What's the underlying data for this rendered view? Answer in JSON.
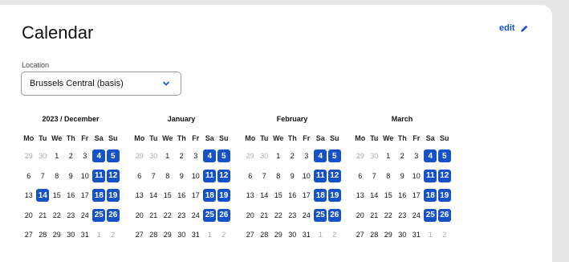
{
  "title": "Calendar",
  "edit_label": "edit",
  "location": {
    "label": "Location",
    "value": "Brussels Central (basis)"
  },
  "weekdays": [
    "Mo",
    "Tu",
    "We",
    "Th",
    "Fr",
    "Sa",
    "Su"
  ],
  "accent": "#1552c8",
  "months": [
    {
      "name": "2023 / December",
      "weeks": [
        [
          {
            "d": "29",
            "m": true
          },
          {
            "d": "30",
            "m": true
          },
          {
            "d": "1"
          },
          {
            "d": "2"
          },
          {
            "d": "3"
          },
          {
            "d": "4",
            "h": true
          },
          {
            "d": "5",
            "h": true
          }
        ],
        [
          {
            "d": "6"
          },
          {
            "d": "7"
          },
          {
            "d": "8"
          },
          {
            "d": "9"
          },
          {
            "d": "10"
          },
          {
            "d": "11",
            "h": true
          },
          {
            "d": "12",
            "h": true
          }
        ],
        [
          {
            "d": "13"
          },
          {
            "d": "14",
            "h": true
          },
          {
            "d": "15"
          },
          {
            "d": "16"
          },
          {
            "d": "17"
          },
          {
            "d": "18",
            "h": true
          },
          {
            "d": "19",
            "h": true
          }
        ],
        [
          {
            "d": "20"
          },
          {
            "d": "21"
          },
          {
            "d": "22"
          },
          {
            "d": "23"
          },
          {
            "d": "24"
          },
          {
            "d": "25",
            "h": true
          },
          {
            "d": "26",
            "h": true
          }
        ],
        [
          {
            "d": "27"
          },
          {
            "d": "28"
          },
          {
            "d": "29"
          },
          {
            "d": "30"
          },
          {
            "d": "31"
          },
          {
            "d": "1",
            "m": true
          },
          {
            "d": "2",
            "m": true
          }
        ]
      ]
    },
    {
      "name": "January",
      "weeks": [
        [
          {
            "d": "29",
            "m": true
          },
          {
            "d": "30",
            "m": true
          },
          {
            "d": "1"
          },
          {
            "d": "2"
          },
          {
            "d": "3"
          },
          {
            "d": "4",
            "h": true
          },
          {
            "d": "5",
            "h": true
          }
        ],
        [
          {
            "d": "6"
          },
          {
            "d": "7"
          },
          {
            "d": "8"
          },
          {
            "d": "9"
          },
          {
            "d": "10"
          },
          {
            "d": "11",
            "h": true
          },
          {
            "d": "12",
            "h": true
          }
        ],
        [
          {
            "d": "13"
          },
          {
            "d": "14"
          },
          {
            "d": "15"
          },
          {
            "d": "16"
          },
          {
            "d": "17"
          },
          {
            "d": "18",
            "h": true
          },
          {
            "d": "19",
            "h": true
          }
        ],
        [
          {
            "d": "20"
          },
          {
            "d": "21"
          },
          {
            "d": "22"
          },
          {
            "d": "23"
          },
          {
            "d": "24"
          },
          {
            "d": "25",
            "h": true
          },
          {
            "d": "26",
            "h": true
          }
        ],
        [
          {
            "d": "27"
          },
          {
            "d": "28"
          },
          {
            "d": "29"
          },
          {
            "d": "30"
          },
          {
            "d": "31"
          },
          {
            "d": "1",
            "m": true
          },
          {
            "d": "2",
            "m": true
          }
        ]
      ]
    },
    {
      "name": "February",
      "weeks": [
        [
          {
            "d": "29",
            "m": true
          },
          {
            "d": "30",
            "m": true
          },
          {
            "d": "1"
          },
          {
            "d": "2"
          },
          {
            "d": "3"
          },
          {
            "d": "4",
            "h": true
          },
          {
            "d": "5",
            "h": true
          }
        ],
        [
          {
            "d": "6"
          },
          {
            "d": "7"
          },
          {
            "d": "8"
          },
          {
            "d": "9"
          },
          {
            "d": "10"
          },
          {
            "d": "11",
            "h": true
          },
          {
            "d": "12",
            "h": true
          }
        ],
        [
          {
            "d": "13"
          },
          {
            "d": "14"
          },
          {
            "d": "15"
          },
          {
            "d": "16"
          },
          {
            "d": "17"
          },
          {
            "d": "18",
            "h": true
          },
          {
            "d": "19",
            "h": true
          }
        ],
        [
          {
            "d": "20"
          },
          {
            "d": "21"
          },
          {
            "d": "22"
          },
          {
            "d": "23"
          },
          {
            "d": "24"
          },
          {
            "d": "25",
            "h": true
          },
          {
            "d": "26",
            "h": true
          }
        ],
        [
          {
            "d": "27"
          },
          {
            "d": "28"
          },
          {
            "d": "29"
          },
          {
            "d": "30"
          },
          {
            "d": "31"
          },
          {
            "d": "1",
            "m": true
          },
          {
            "d": "2",
            "m": true
          }
        ]
      ]
    },
    {
      "name": "March",
      "weeks": [
        [
          {
            "d": "29",
            "m": true
          },
          {
            "d": "30",
            "m": true
          },
          {
            "d": "1"
          },
          {
            "d": "2"
          },
          {
            "d": "3"
          },
          {
            "d": "4",
            "h": true
          },
          {
            "d": "5",
            "h": true
          }
        ],
        [
          {
            "d": "6"
          },
          {
            "d": "7"
          },
          {
            "d": "8"
          },
          {
            "d": "9"
          },
          {
            "d": "10"
          },
          {
            "d": "11",
            "h": true
          },
          {
            "d": "12",
            "h": true
          }
        ],
        [
          {
            "d": "13"
          },
          {
            "d": "14"
          },
          {
            "d": "15"
          },
          {
            "d": "16"
          },
          {
            "d": "17"
          },
          {
            "d": "18",
            "h": true
          },
          {
            "d": "19",
            "h": true
          }
        ],
        [
          {
            "d": "20"
          },
          {
            "d": "21"
          },
          {
            "d": "22"
          },
          {
            "d": "23"
          },
          {
            "d": "24"
          },
          {
            "d": "25",
            "h": true
          },
          {
            "d": "26",
            "h": true
          }
        ],
        [
          {
            "d": "27"
          },
          {
            "d": "28"
          },
          {
            "d": "29"
          },
          {
            "d": "30"
          },
          {
            "d": "31"
          },
          {
            "d": "1",
            "m": true
          },
          {
            "d": "2",
            "m": true
          }
        ]
      ]
    }
  ]
}
